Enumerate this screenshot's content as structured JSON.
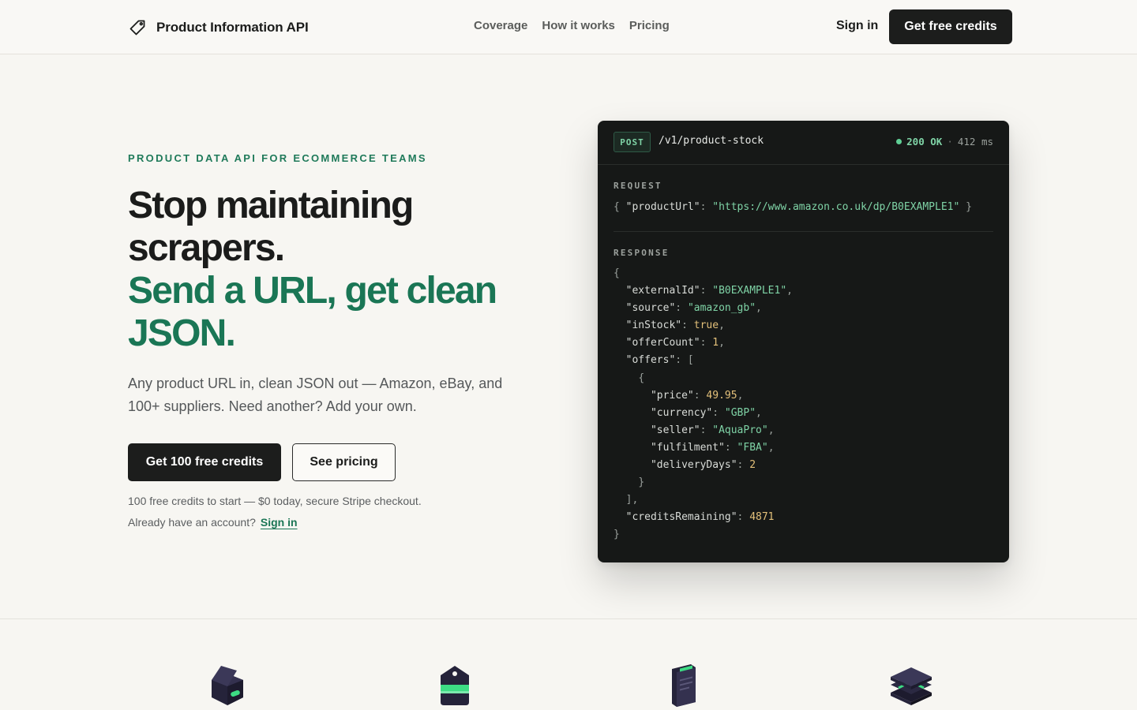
{
  "header": {
    "brand_name": "Product Information API",
    "nav": [
      "Coverage",
      "How it works",
      "Pricing"
    ],
    "sign_in": "Sign in",
    "cta": "Get free credits"
  },
  "hero": {
    "eyebrow": "PRODUCT DATA API FOR ECOMMERCE TEAMS",
    "headline_line1": "Stop maintaining scrapers.",
    "headline_line2": "Send a URL, get clean JSON.",
    "subtext": "Any product URL in, clean JSON out — Amazon, eBay, and 100+ suppliers. Need another? Add your own.",
    "primary_button": "Get 100 free credits",
    "secondary_button": "See pricing",
    "fine_print": "100 free credits to start — $0 today, secure Stripe checkout.",
    "already_text": "Already have an account?",
    "sign_in_link": "Sign in"
  },
  "code_card": {
    "method": "POST",
    "endpoint": "/v1/product-stock",
    "status_code": "200 OK",
    "status_separator": "·",
    "latency": "412 ms",
    "request_label": "REQUEST",
    "request": {
      "productUrl": "https://www.amazon.co.uk/dp/B0EXAMPLE1"
    },
    "response_label": "RESPONSE",
    "response": {
      "externalId": "B0EXAMPLE1",
      "source": "amazon_gb",
      "inStock": "true",
      "offerCount": "1",
      "offers": [
        {
          "price": "49.95",
          "currency": "GBP",
          "seller": "AquaPro",
          "fulfilment": "FBA",
          "deliveryDays": "2"
        }
      ],
      "creditsRemaining": "4871"
    }
  },
  "features": {
    "icons": [
      "box-icon",
      "price-tag-icon",
      "document-icon",
      "stack-icon"
    ]
  },
  "colors": {
    "accent_green": "#1a7655",
    "dark": "#1c1d1c",
    "page_bg": "#f7f6f2",
    "code_bg": "#161817",
    "code_string": "#7fd3a6",
    "code_number": "#e3c07a"
  }
}
